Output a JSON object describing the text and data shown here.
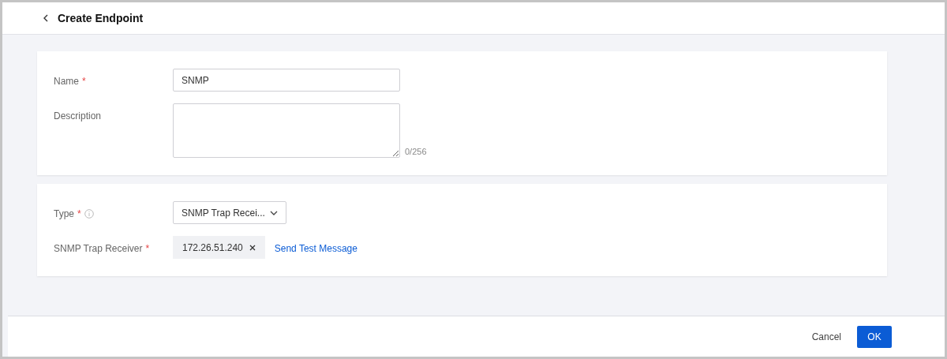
{
  "header": {
    "title": "Create Endpoint"
  },
  "sections": [
    {
      "fields": [
        {
          "kind": "input",
          "label": "Name",
          "required_mark": "*",
          "value": "SNMP"
        },
        {
          "kind": "textarea",
          "label": "Description",
          "counter": "0/256"
        }
      ]
    },
    {
      "fields": [
        {
          "kind": "select",
          "label": "Type",
          "required_mark": "*",
          "info": true,
          "value": "SNMP Trap Recei..."
        },
        {
          "kind": "tags",
          "label": "SNMP Trap Receiver",
          "required_mark": "*",
          "tags": [
            "172.26.51.240"
          ],
          "link": "Send Test Message"
        }
      ]
    }
  ],
  "footer": {
    "cancel": "Cancel",
    "ok": "OK"
  }
}
